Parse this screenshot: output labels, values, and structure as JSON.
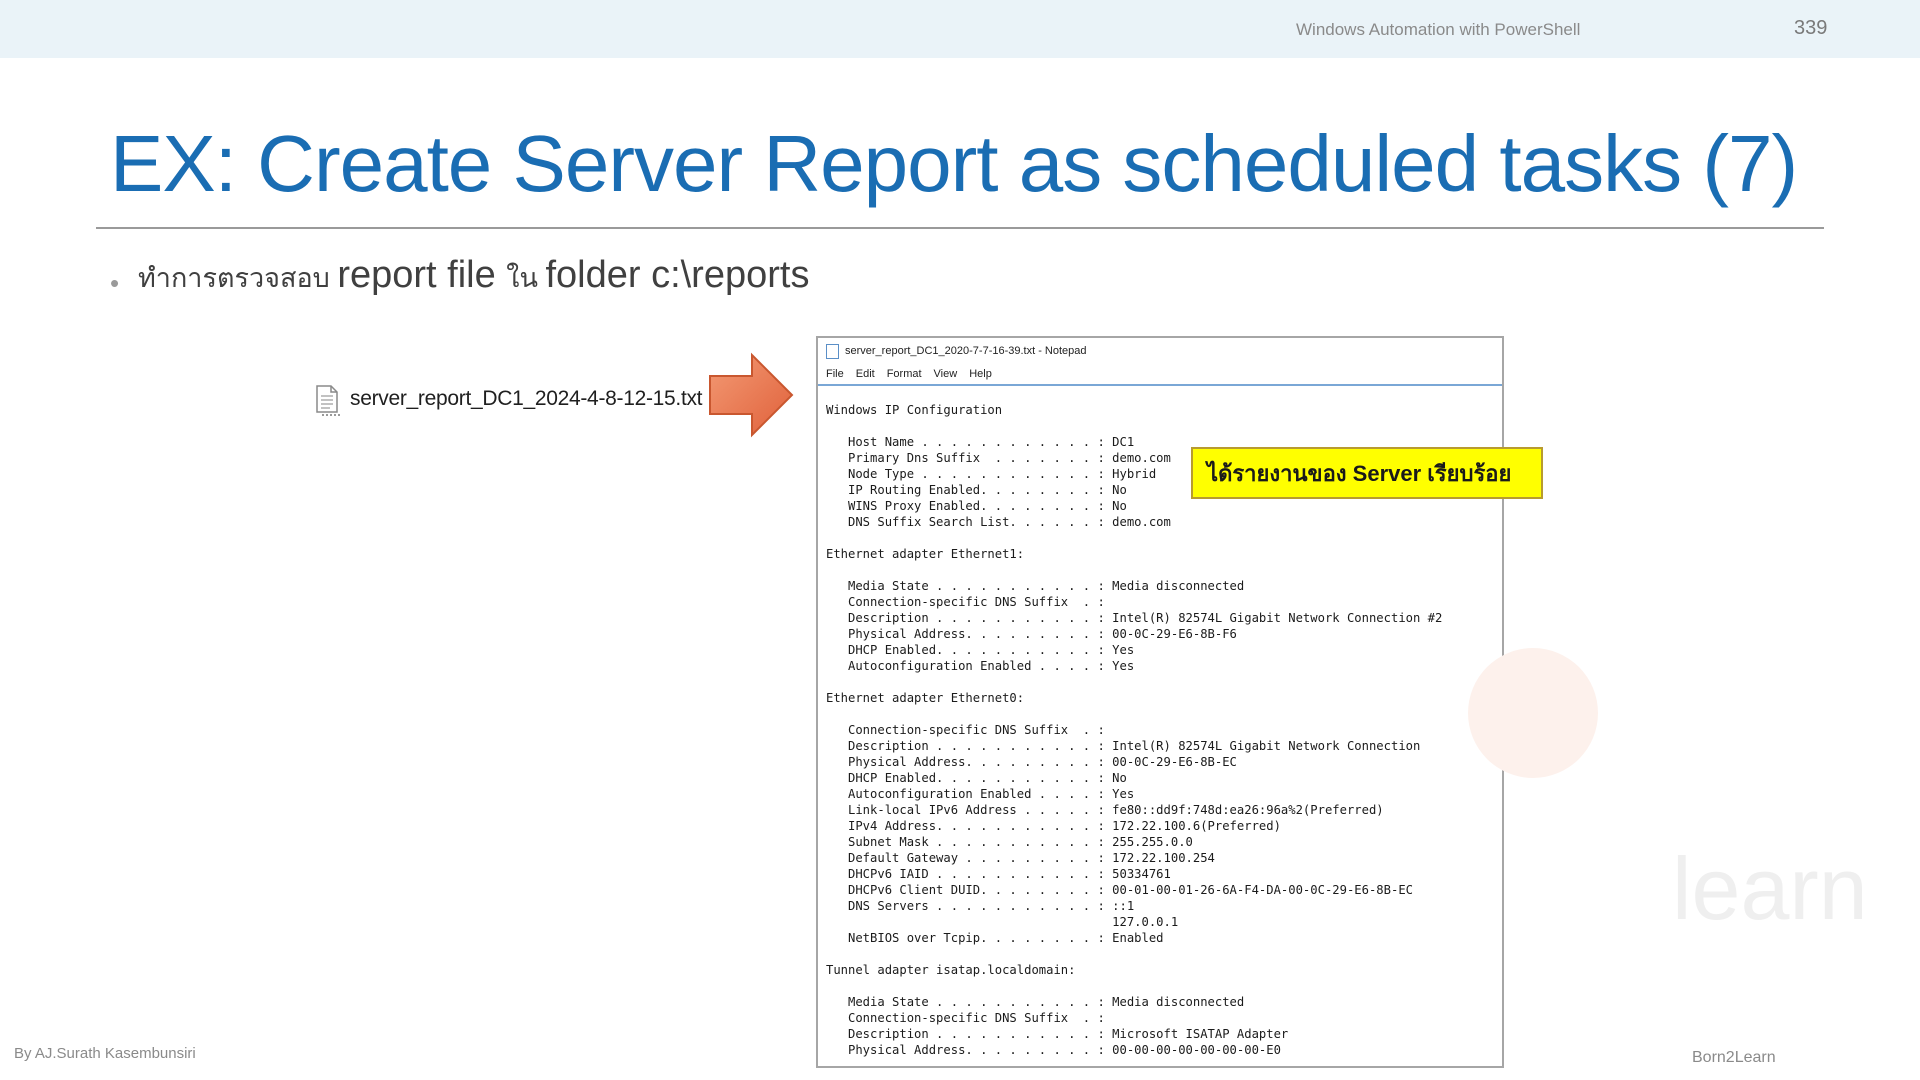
{
  "header": {
    "course": "Windows Automation with PowerShell",
    "page_number": "339"
  },
  "title": "EX: Create Server Report as scheduled tasks (7)",
  "bullet": {
    "thai_1": "ทำการตรวจสอบ ",
    "en_1": "report file ",
    "thai_2": "ใน ",
    "en_2": "folder  c:\\reports"
  },
  "file": {
    "name": "server_report_DC1_2024-4-8-12-15.txt",
    "icon": "text-file-icon"
  },
  "notepad": {
    "title": "server_report_DC1_2020-7-7-16-39.txt - Notepad",
    "menu": [
      "File",
      "Edit",
      "Format",
      "View",
      "Help"
    ],
    "content": "Windows IP Configuration\n\n   Host Name . . . . . . . . . . . . : DC1\n   Primary Dns Suffix  . . . . . . . : demo.com\n   Node Type . . . . . . . . . . . . : Hybrid\n   IP Routing Enabled. . . . . . . . : No\n   WINS Proxy Enabled. . . . . . . . : No\n   DNS Suffix Search List. . . . . . : demo.com\n\nEthernet adapter Ethernet1:\n\n   Media State . . . . . . . . . . . : Media disconnected\n   Connection-specific DNS Suffix  . :\n   Description . . . . . . . . . . . : Intel(R) 82574L Gigabit Network Connection #2\n   Physical Address. . . . . . . . . : 00-0C-29-E6-8B-F6\n   DHCP Enabled. . . . . . . . . . . : Yes\n   Autoconfiguration Enabled . . . . : Yes\n\nEthernet adapter Ethernet0:\n\n   Connection-specific DNS Suffix  . :\n   Description . . . . . . . . . . . : Intel(R) 82574L Gigabit Network Connection\n   Physical Address. . . . . . . . . : 00-0C-29-E6-8B-EC\n   DHCP Enabled. . . . . . . . . . . : No\n   Autoconfiguration Enabled . . . . : Yes\n   Link-local IPv6 Address . . . . . : fe80::dd9f:748d:ea26:96a%2(Preferred)\n   IPv4 Address. . . . . . . . . . . : 172.22.100.6(Preferred)\n   Subnet Mask . . . . . . . . . . . : 255.255.0.0\n   Default Gateway . . . . . . . . . : 172.22.100.254\n   DHCPv6 IAID . . . . . . . . . . . : 50334761\n   DHCPv6 Client DUID. . . . . . . . : 00-01-00-01-26-6A-F4-DA-00-0C-29-E6-8B-EC\n   DNS Servers . . . . . . . . . . . : ::1\n                                       127.0.0.1\n   NetBIOS over Tcpip. . . . . . . . : Enabled\n\nTunnel adapter isatap.localdomain:\n\n   Media State . . . . . . . . . . . : Media disconnected\n   Connection-specific DNS Suffix  . :\n   Description . . . . . . . . . . . : Microsoft ISATAP Adapter\n   Physical Address. . . . . . . . . : 00-00-00-00-00-00-00-E0"
  },
  "callout": "ได้รายงานของ Server เรียบร้อย",
  "watermark": "learn",
  "footer": {
    "author": "By AJ.Surath Kasembunsiri",
    "brand": "Born2Learn"
  },
  "colors": {
    "title": "#1a6db3",
    "topbar": "#eaf3f8",
    "callout_bg": "#ffff00",
    "arrow": "#f07c4a"
  }
}
